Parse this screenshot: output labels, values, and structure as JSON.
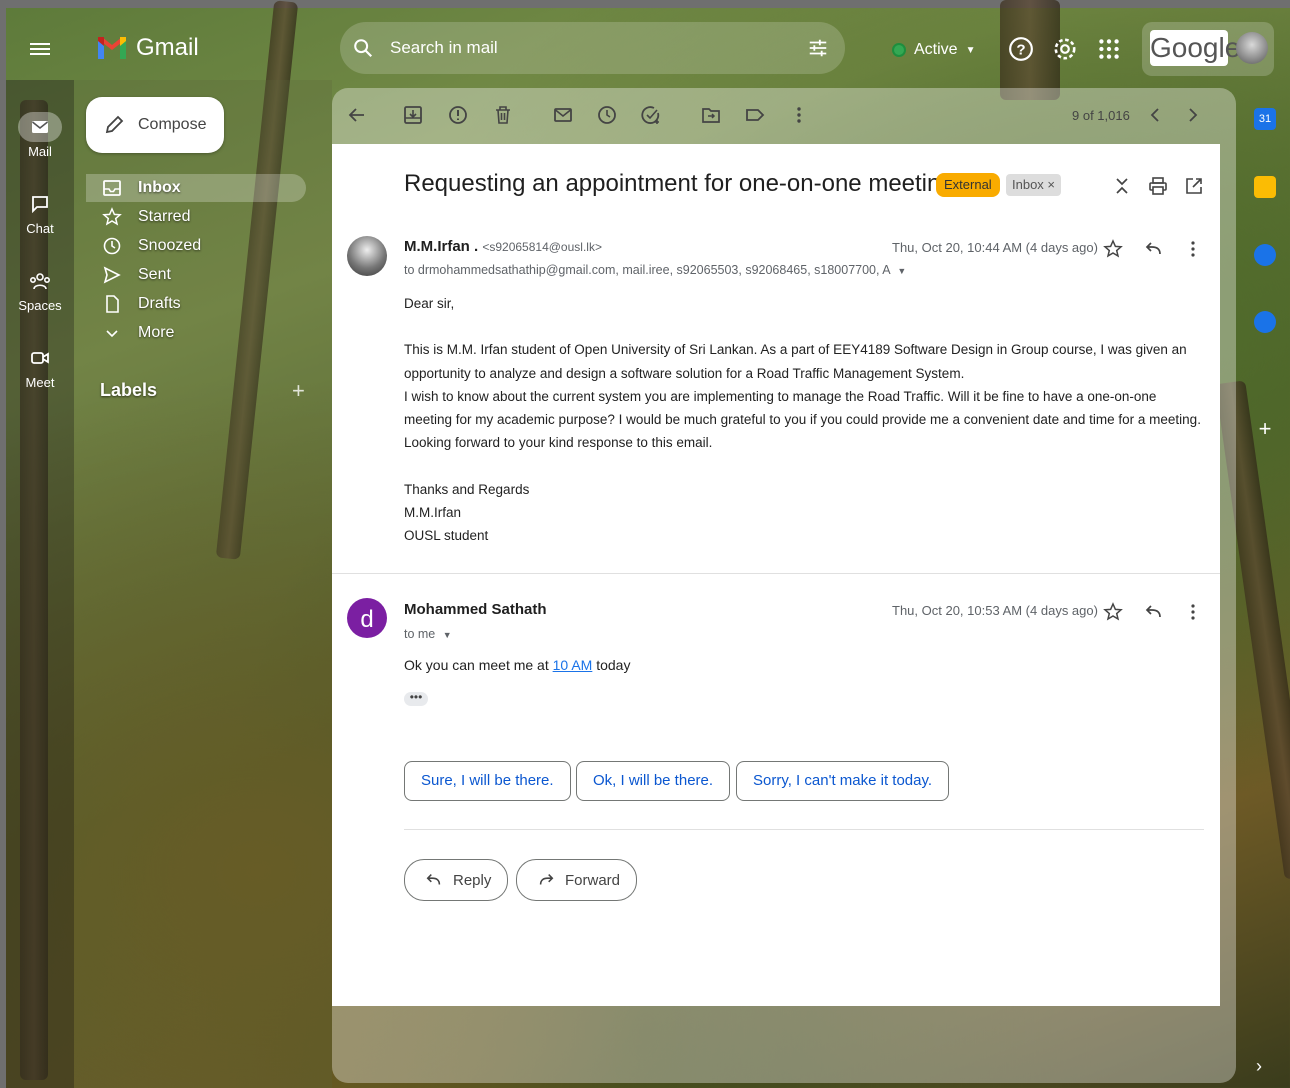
{
  "app": {
    "name": "Gmail"
  },
  "search": {
    "placeholder": "Search in mail"
  },
  "status": {
    "label": "Active"
  },
  "google": {
    "wordmark": "Google"
  },
  "rail": [
    {
      "label": "Mail",
      "icon": "mail-icon",
      "active": true
    },
    {
      "label": "Chat",
      "icon": "chat-icon"
    },
    {
      "label": "Spaces",
      "icon": "spaces-icon"
    },
    {
      "label": "Meet",
      "icon": "meet-icon"
    }
  ],
  "compose": {
    "label": "Compose"
  },
  "nav": [
    {
      "label": "Inbox",
      "icon": "inbox-icon",
      "active": true
    },
    {
      "label": "Starred",
      "icon": "star-icon"
    },
    {
      "label": "Snoozed",
      "icon": "clock-icon"
    },
    {
      "label": "Sent",
      "icon": "send-icon"
    },
    {
      "label": "Drafts",
      "icon": "draft-icon"
    },
    {
      "label": "More",
      "icon": "chevron-down-icon"
    }
  ],
  "labels": {
    "heading": "Labels"
  },
  "toolbar": {
    "counter": "9 of 1,016"
  },
  "thread": {
    "subject": "Requesting an appointment for one-on-one meeting",
    "badge_external": "External",
    "badge_inbox": "Inbox ×"
  },
  "message1": {
    "sender": "M.M.Irfan .",
    "email": "<s92065814@ousl.lk>",
    "recipients": "to drmohammedsathathip@gmail.com, mail.iree, s92065503, s92068465, s18007700, A",
    "date": "Thu, Oct 20, 10:44 AM (4 days ago)",
    "greeting": "Dear sir,",
    "p1": "This is M.M. Irfan student of Open University of Sri Lankan. As a part of EEY4189 Software Design in Group course, I was given an opportunity to analyze and design a software solution for a Road Traffic Management System.",
    "p2": "I wish to know about the current system you are implementing to manage the Road Traffic. Will it be fine to have a one-on-one meeting for my academic purpose? I would be much grateful to you if you could provide me a convenient date and time for a meeting.",
    "p3": "Looking forward to your kind response to this email.",
    "sig1": "Thanks and Regards",
    "sig2": "M.M.Irfan",
    "sig3": "OUSL student"
  },
  "message2": {
    "avatar_letter": "d",
    "sender": "Mohammed Sathath",
    "recipients": "to me",
    "date": "Thu, Oct 20, 10:53 AM (4 days ago)",
    "body_before": "Ok you can meet me at ",
    "body_link": "10 AM",
    "body_after": " today",
    "trimmed": "•••"
  },
  "smart_replies": [
    "Sure, I will be there.",
    "Ok, I will be there.",
    "Sorry, I can't make it today."
  ],
  "actions": {
    "reply": "Reply",
    "forward": "Forward"
  },
  "colors": {
    "external_badge": "#f9ab00",
    "avatar_d": "#7b1fa2",
    "link": "#1a73e8",
    "active_dot": "#34a853"
  }
}
